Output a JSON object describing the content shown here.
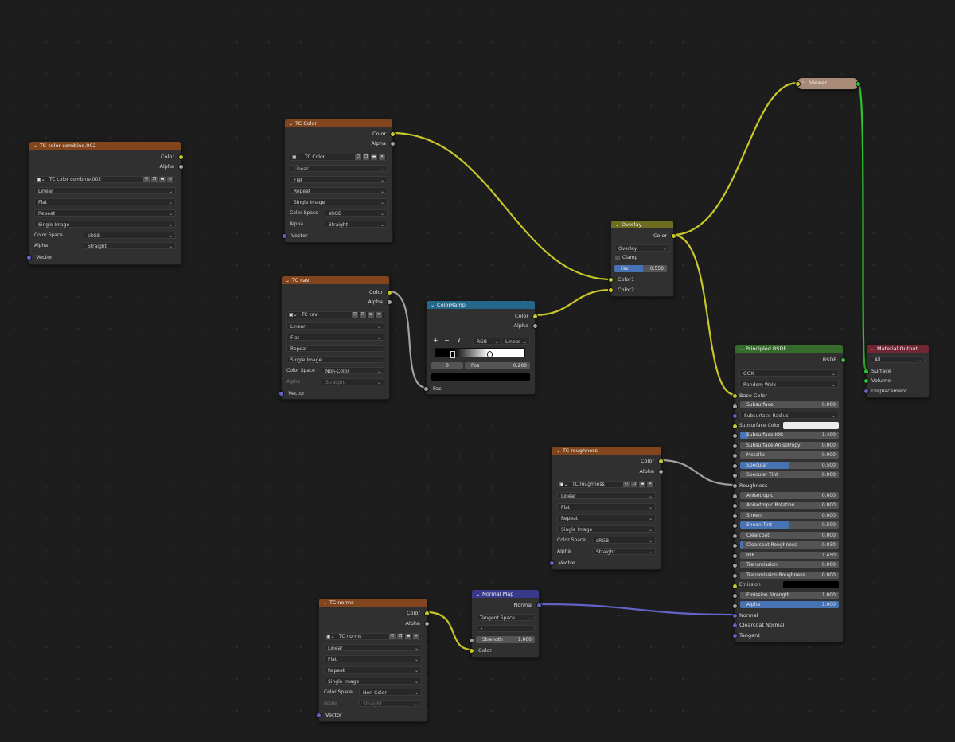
{
  "colors": {
    "texture_header": "#82451d",
    "overlay_header": "#6f6d1f",
    "colorramp_header": "#23688a",
    "normalmap_header": "#3a3a8c",
    "bsdf_header": "#356c2b",
    "output_header": "#712633",
    "viewer_header": "#a88a76",
    "socket_color": "#c7c729",
    "socket_float": "#a1a1a1",
    "socket_vector": "#6363c7",
    "socket_shader": "#2ec22e",
    "slider_fill": "#4772b3"
  },
  "icons": [
    "chevron-down-icon",
    "image-icon",
    "shield-icon",
    "duplicate-icon",
    "folder-icon",
    "close-icon",
    "checkbox-icon",
    "plus-icon",
    "minus-icon"
  ],
  "tc_combine": {
    "title": "TC color combine.002",
    "out_color": "Color",
    "out_alpha": "Alpha",
    "image": "TC color combine.002",
    "interp": "Linear",
    "proj": "Flat",
    "ext": "Repeat",
    "src": "Single Image",
    "cs_label": "Color Space",
    "cs_value": "sRGB",
    "alpha_label": "Alpha",
    "alpha_value": "Straight",
    "in_vector": "Vector"
  },
  "tc_color": {
    "title": "TC Color",
    "out_color": "Color",
    "out_alpha": "Alpha",
    "image": "TC Color",
    "interp": "Linear",
    "proj": "Flat",
    "ext": "Repeat",
    "src": "Single Image",
    "cs_label": "Color Space",
    "cs_value": "sRGB",
    "alpha_label": "Alpha",
    "alpha_value": "Straight",
    "in_vector": "Vector"
  },
  "tc_cav": {
    "title": "TC cav",
    "out_color": "Color",
    "out_alpha": "Alpha",
    "image": "TC cav",
    "interp": "Linear",
    "proj": "Flat",
    "ext": "Repeat",
    "src": "Single Image",
    "cs_label": "Color Space",
    "cs_value": "Non-Color",
    "alpha_label": "Alpha",
    "alpha_value": "Straight",
    "in_vector": "Vector"
  },
  "tc_rough": {
    "title": "TC roughness",
    "out_color": "Color",
    "out_alpha": "Alpha",
    "image": "TC roughness",
    "interp": "Linear",
    "proj": "Flat",
    "ext": "Repeat",
    "src": "Single Image",
    "cs_label": "Color Space",
    "cs_value": "sRGB",
    "alpha_label": "Alpha",
    "alpha_value": "Straight",
    "in_vector": "Vector"
  },
  "tc_norms": {
    "title": "TC norms",
    "out_color": "Color",
    "out_alpha": "Alpha",
    "image": "TC norms",
    "interp": "Linear",
    "proj": "Flat",
    "ext": "Repeat",
    "src": "Single Image",
    "cs_label": "Color Space",
    "cs_value": "Non-Color",
    "alpha_label": "Alpha",
    "alpha_value": "Straight",
    "in_vector": "Vector"
  },
  "colorramp": {
    "title": "ColorRamp",
    "out_color": "Color",
    "out_alpha": "Alpha",
    "plus": "+",
    "minus": "−",
    "chev": "∨",
    "mode": "RGB",
    "interp": "Linear",
    "index": "0",
    "pos_label": "Pos",
    "pos_value": "0.200",
    "stop_position": 0.2,
    "in_fac": "Fac"
  },
  "overlay": {
    "title": "Overlay",
    "out_color": "Color",
    "blend": "Overlay",
    "clamp": "Clamp",
    "fac_label": "Fac",
    "fac_value": "0.550",
    "fac_fraction": 0.55,
    "in_color1": "Color1",
    "in_color2": "Color2"
  },
  "viewer": {
    "title": "Viewer"
  },
  "normalmap": {
    "title": "Normal Map",
    "out_normal": "Normal",
    "space": "Tangent Space",
    "uvmap": "•",
    "strength_label": "Strength",
    "strength_value": "1.000",
    "in_color": "Color"
  },
  "bsdf": {
    "title": "Principled BSDF",
    "out_bsdf": "BSDF",
    "distribution": "GGX",
    "sss_method": "Random Walk",
    "base_color": "Base Color",
    "subsurface": {
      "label": "Subsurface",
      "value": "0.000"
    },
    "subsurface_radius": "Subsurface Radius",
    "subsurface_color": "Subsurface Color",
    "subsurface_ior": {
      "label": "Subsurface IOR",
      "value": "1.400",
      "fraction": 0.08
    },
    "subsurface_aniso": {
      "label": "Subsurface Anisotropy",
      "value": "0.000"
    },
    "metallic": {
      "label": "Metallic",
      "value": "0.000"
    },
    "specular": {
      "label": "Specular",
      "value": "0.500",
      "fraction": 0.5
    },
    "specular_tint": {
      "label": "Specular Tint",
      "value": "0.000"
    },
    "roughness": "Roughness",
    "anisotropic": {
      "label": "Anisotropic",
      "value": "0.000"
    },
    "aniso_rotation": {
      "label": "Anisotropic Rotation",
      "value": "0.000"
    },
    "sheen": {
      "label": "Sheen",
      "value": "0.000"
    },
    "sheen_tint": {
      "label": "Sheen Tint",
      "value": "0.500",
      "fraction": 0.5
    },
    "clearcoat": {
      "label": "Clearcoat",
      "value": "0.000"
    },
    "clearcoat_rough": {
      "label": "Clearcoat Roughness",
      "value": "0.030",
      "fraction": 0.03
    },
    "ior": {
      "label": "IOR",
      "value": "1.450"
    },
    "transmission": {
      "label": "Transmission",
      "value": "0.000"
    },
    "transmission_rough": {
      "label": "Transmission Roughness",
      "value": "0.000"
    },
    "emission": "Emission",
    "emission_strength": {
      "label": "Emission Strength",
      "value": "1.000"
    },
    "alpha": {
      "label": "Alpha",
      "value": "1.000",
      "fraction": 1.0
    },
    "normal": "Normal",
    "clearcoat_normal": "Clearcoat Normal",
    "tangent": "Tangent"
  },
  "matout": {
    "title": "Material Output",
    "target": "All",
    "in_surface": "Surface",
    "in_volume": "Volume",
    "in_displacement": "Displacement"
  }
}
